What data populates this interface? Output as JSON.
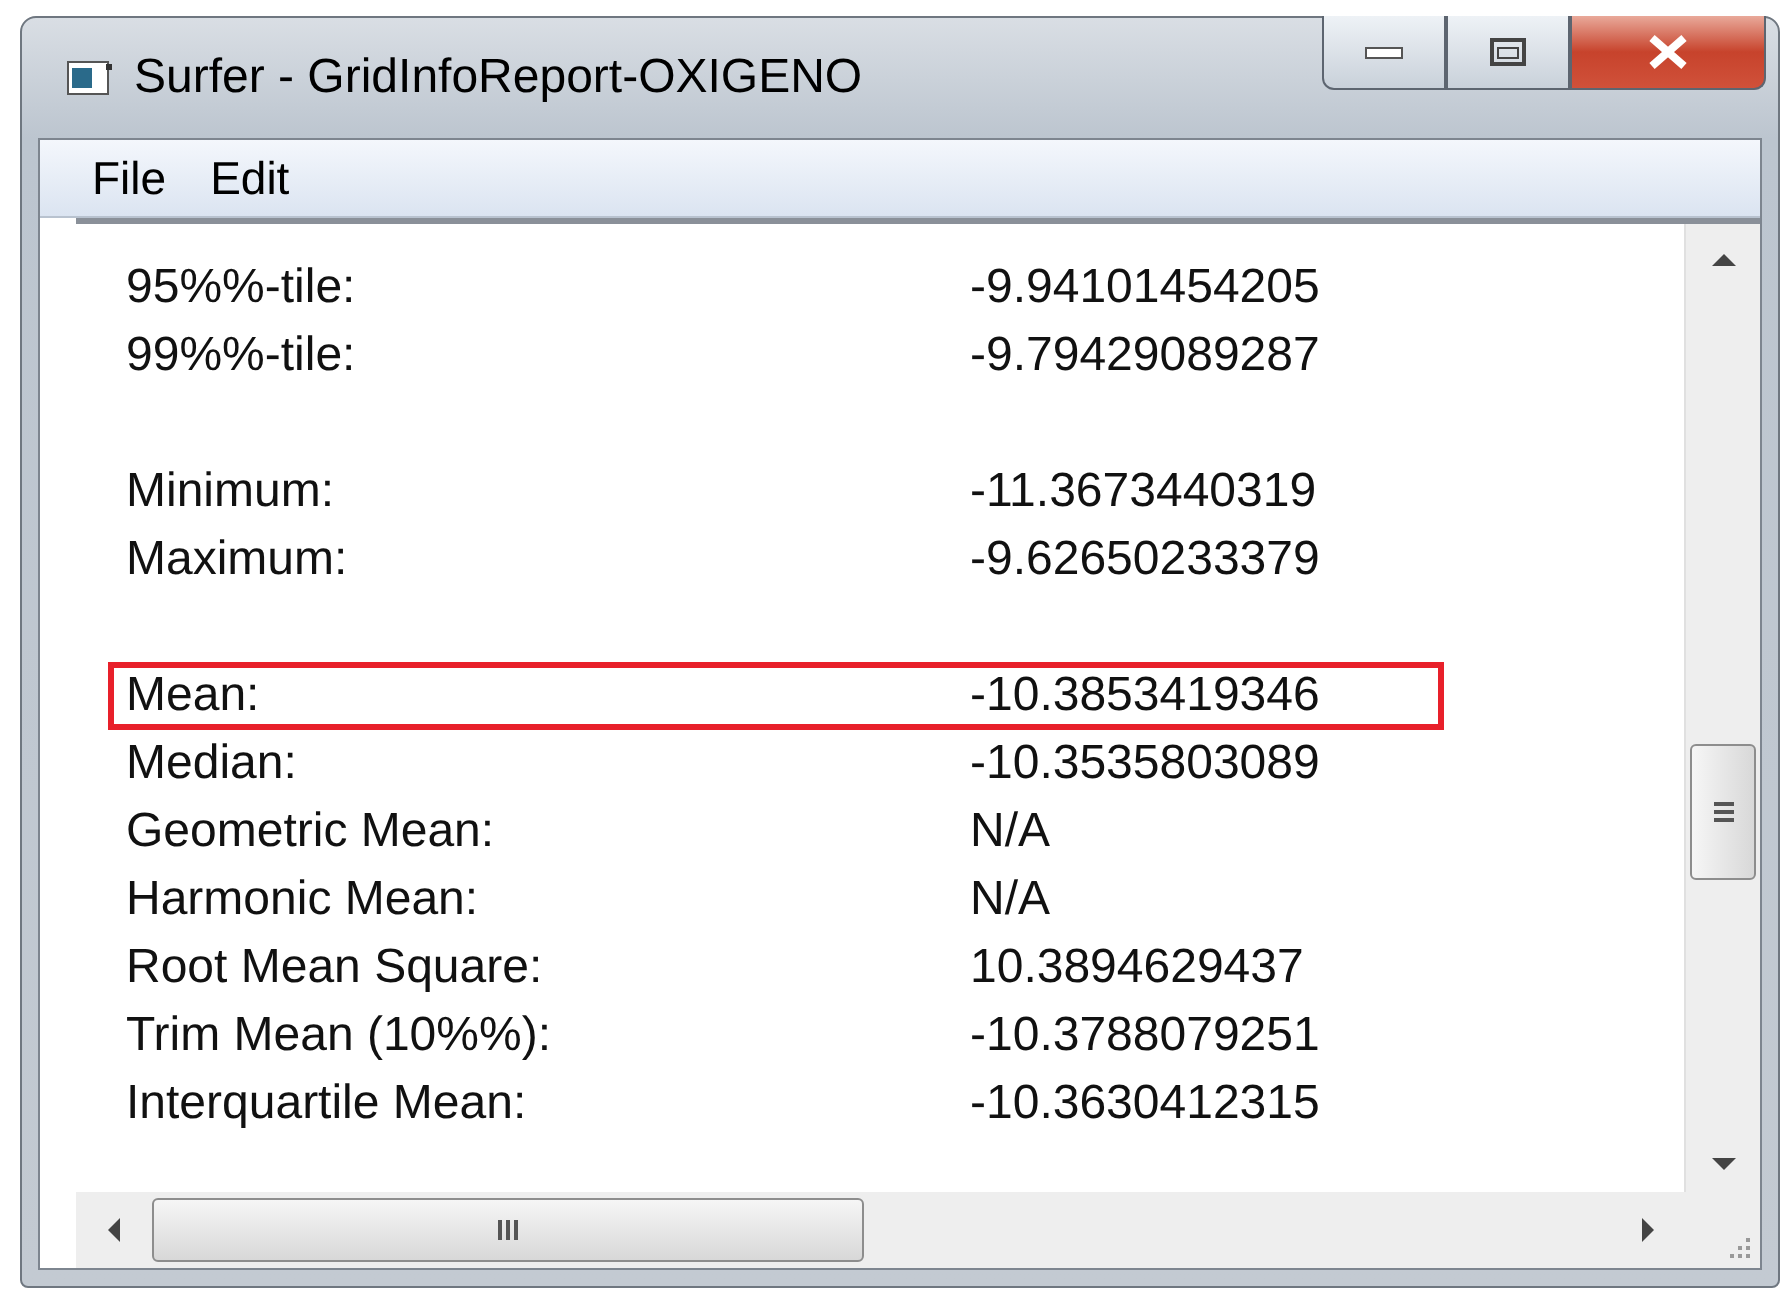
{
  "window": {
    "title": "Surfer - GridInfoReport-OXIGENO"
  },
  "menu": [
    "File",
    "Edit"
  ],
  "rows": [
    {
      "kind": "row",
      "label": "95%%-tile:",
      "value": "-9.94101454205",
      "highlighted": false
    },
    {
      "kind": "row",
      "label": "99%%-tile:",
      "value": "-9.79429089287",
      "highlighted": false
    },
    {
      "kind": "blank"
    },
    {
      "kind": "row",
      "label": "Minimum:",
      "value": "-11.3673440319",
      "highlighted": false
    },
    {
      "kind": "row",
      "label": "Maximum:",
      "value": "-9.62650233379",
      "highlighted": false
    },
    {
      "kind": "blank"
    },
    {
      "kind": "row",
      "label": "Mean:",
      "value": "-10.3853419346",
      "highlighted": true
    },
    {
      "kind": "row",
      "label": "Median:",
      "value": "-10.3535803089",
      "highlighted": false
    },
    {
      "kind": "row",
      "label": "Geometric Mean:",
      "value": "N/A",
      "highlighted": false
    },
    {
      "kind": "row",
      "label": "Harmonic Mean:",
      "value": "N/A",
      "highlighted": false
    },
    {
      "kind": "row",
      "label": "Root Mean Square:",
      "value": "10.3894629437",
      "highlighted": false
    },
    {
      "kind": "row",
      "label": "Trim Mean (10%%):",
      "value": "-10.3788079251",
      "highlighted": false
    },
    {
      "kind": "row",
      "label": "Interquartile Mean:",
      "value": "-10.3630412315",
      "highlighted": false
    }
  ]
}
